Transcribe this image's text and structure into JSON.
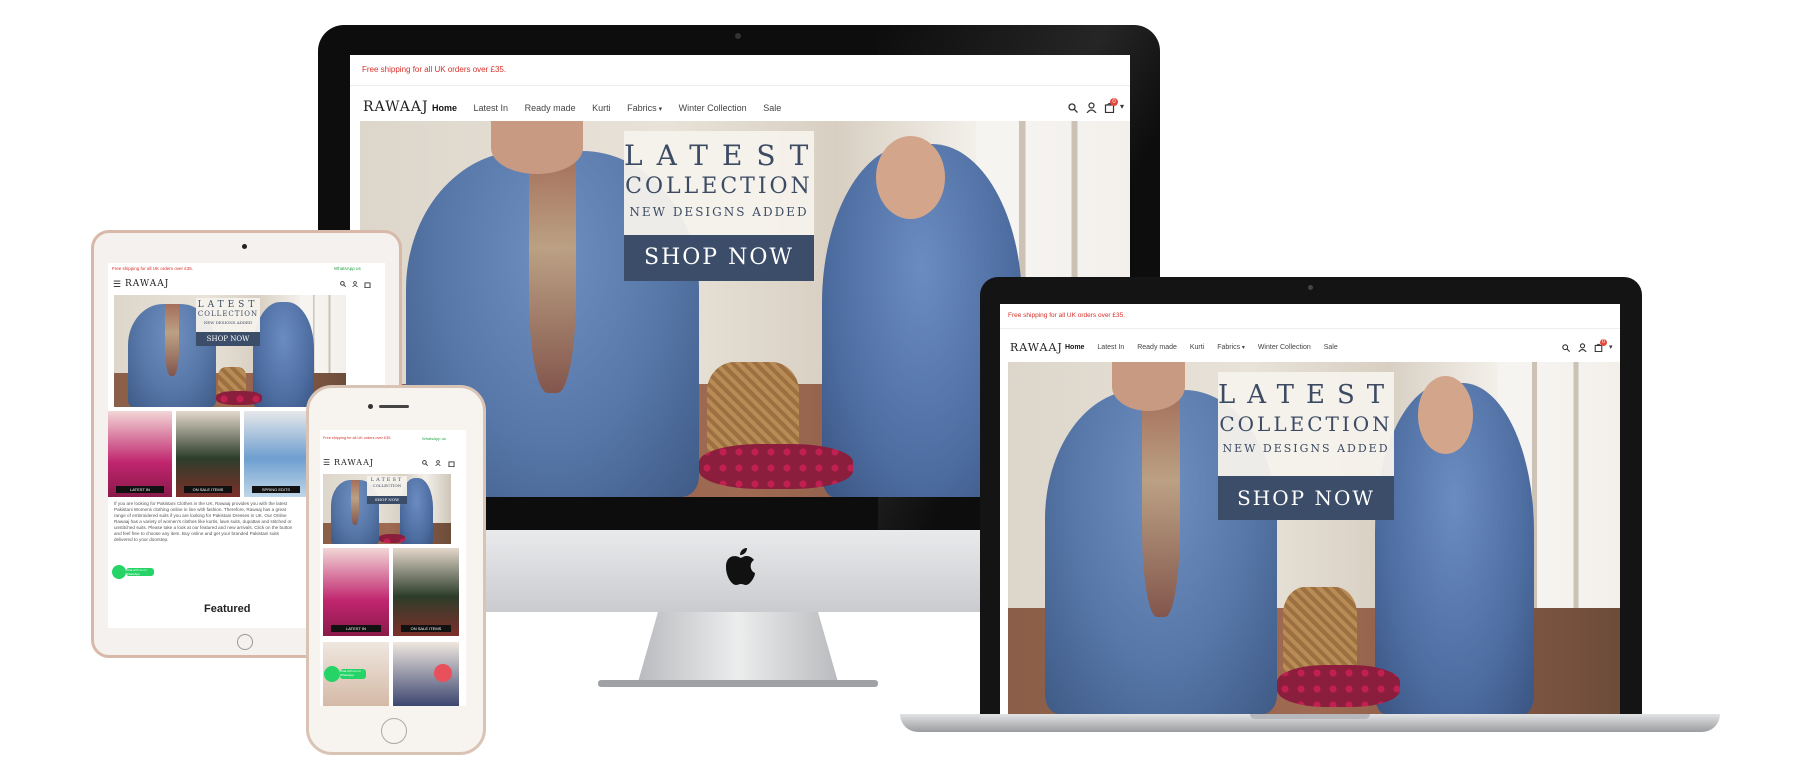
{
  "site": {
    "shipping_notice": "Free shipping for all UK orders over £35.",
    "whatsapp_label": "WhatsApp us",
    "logo": "RAWAAJ",
    "cart_count": "0",
    "nav": [
      "Home",
      "Latest In",
      "Ready made",
      "Kurti",
      "Fabrics",
      "Winter Collection",
      "Sale"
    ],
    "hero": {
      "line1": "LATEST",
      "line2": "COLLECTION",
      "line3": "NEW DESIGNS ADDED",
      "cta": "SHOP NOW"
    },
    "category_tiles": [
      "LATEST IN",
      "ON SALE ITEMS",
      "SPRING EDITS"
    ],
    "intro_text": "If you are looking for Pakistani Clothes in the UK, Rawaaj provides you with the latest Pakistani Womens clothing online in line with fashion. Therefore, Rawaaj has a great range of embroidered suits if you are looking for Pakistani Dresses in UK. Our Online Rawaaj has a variety of women's clothes like kurtis, lawn suits, dupattas and stitched or unstitched suits. Please take a look at our featured and new arrivals. Click on the button and feel free to choose any item. Buy online and get your branded Pakistani suits delivered to your doorstep.",
    "featured_heading": "Featured",
    "whatsapp_bubble": "Chat with us on WhatsApp"
  },
  "colors": {
    "accent_red": "#d6312b",
    "cta_navy": "#3b4d68",
    "whatsapp_green": "#25d366"
  },
  "icons": [
    "search-icon",
    "user-icon",
    "cart-icon",
    "chevron-down-icon",
    "menu-icon",
    "whatsapp-icon",
    "chat-icon",
    "apple-logo-icon"
  ]
}
